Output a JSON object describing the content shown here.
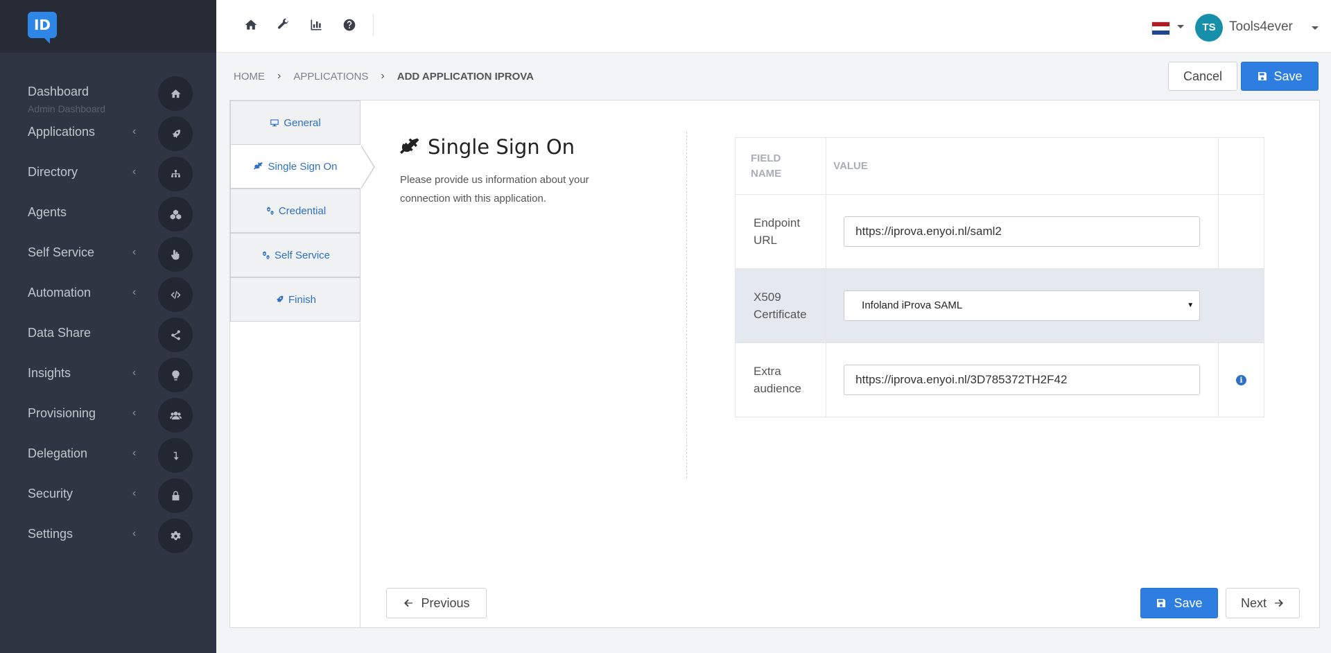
{
  "app": {
    "logo_text": "ID"
  },
  "sidebar": {
    "items": [
      {
        "label": "Dashboard",
        "sub": "Admin Dashboard",
        "icon": "home-icon",
        "chevron": false
      },
      {
        "label": "Applications",
        "icon": "rocket-icon",
        "chevron": true
      },
      {
        "label": "Directory",
        "icon": "sitemap-icon",
        "chevron": true
      },
      {
        "label": "Agents",
        "icon": "cubes-icon",
        "chevron": false
      },
      {
        "label": "Self Service",
        "icon": "hand-pointer-icon",
        "chevron": true
      },
      {
        "label": "Automation",
        "icon": "code-icon",
        "chevron": true
      },
      {
        "label": "Data Share",
        "icon": "share-icon",
        "chevron": false
      },
      {
        "label": "Insights",
        "icon": "lightbulb-icon",
        "chevron": true
      },
      {
        "label": "Provisioning",
        "icon": "users-icon",
        "chevron": true
      },
      {
        "label": "Delegation",
        "icon": "level-down-icon",
        "chevron": true
      },
      {
        "label": "Security",
        "icon": "lock-icon",
        "chevron": true
      },
      {
        "label": "Settings",
        "icon": "gear-icon",
        "chevron": true
      }
    ],
    "chevron_glyph": "‹"
  },
  "topbar": {
    "icons": [
      "home-icon",
      "wrench-icon",
      "bar-chart-icon",
      "question-icon"
    ],
    "user": {
      "initials": "TS",
      "name": "Tools4ever"
    },
    "language_flag": "flag-nl-icon"
  },
  "breadcrumb": {
    "items": [
      "HOME",
      "APPLICATIONS"
    ],
    "current": "ADD APPLICATION IPROVA",
    "separator": "›"
  },
  "header_actions": {
    "cancel": "Cancel",
    "save": "Save"
  },
  "tabs": [
    {
      "label": "General",
      "icon": "desktop-icon",
      "active": false
    },
    {
      "label": "Single Sign On",
      "icon": "plug-icon",
      "active": true
    },
    {
      "label": "Credential",
      "icon": "cogs-icon",
      "active": false
    },
    {
      "label": "Self Service",
      "icon": "cogs-icon",
      "active": false
    },
    {
      "label": "Finish",
      "icon": "rocket-icon",
      "active": false
    }
  ],
  "section": {
    "title": "Single Sign On",
    "description": "Please provide us information about your connection with this application."
  },
  "table": {
    "headers": {
      "name": "FIELD NAME",
      "value": "VALUE"
    },
    "rows": [
      {
        "name": "Endpoint URL",
        "type": "text",
        "value": "https://iprova.enyoi.nl/saml2"
      },
      {
        "name": "X509 Certificate",
        "type": "select",
        "value": "Infoland iProva SAML"
      },
      {
        "name": "Extra audience",
        "type": "text",
        "value": "https://iprova.enyoi.nl/3D785372TH2F42",
        "info": "i"
      }
    ]
  },
  "footer": {
    "previous": "Previous",
    "save": "Save",
    "next": "Next"
  },
  "colors": {
    "sidebar_bg": "#2f3542",
    "primary": "#2e7de1",
    "link": "#2e6fc7",
    "avatar": "#178fa8"
  }
}
